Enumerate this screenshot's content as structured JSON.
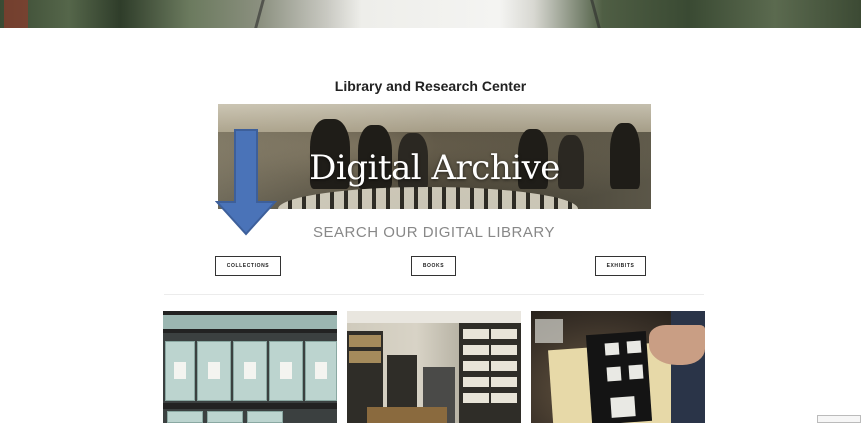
{
  "header": {
    "site_title": "Library and Research Center"
  },
  "banner": {
    "title": "Digital Archive"
  },
  "search": {
    "heading": "SEARCH OUR DIGITAL LIBRARY"
  },
  "buttons": {
    "collections": "COLLECTIONS",
    "books": "BOOKS",
    "exhibits": "EXHIBITS"
  },
  "annotation": {
    "arrow_color": "#4a73b8",
    "arrow_icon": "arrow-down-icon"
  },
  "colors": {
    "heading_text": "#222222",
    "search_text": "#888888",
    "button_border": "#333333"
  }
}
